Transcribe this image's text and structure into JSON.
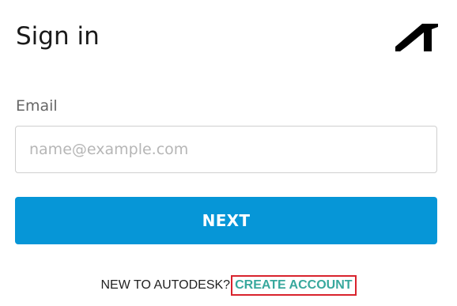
{
  "header": {
    "title": "Sign in",
    "logo_icon": "autodesk-logo-icon"
  },
  "form": {
    "email_label": "Email",
    "email_placeholder": "name@example.com",
    "email_value": "",
    "next_label": "NEXT"
  },
  "footer": {
    "prompt": "NEW TO AUTODESK?",
    "create_account_label": "CREATE ACCOUNT"
  },
  "colors": {
    "primary_button": "#0696d7",
    "link": "#38a89d",
    "highlight_outline": "#d9232d"
  }
}
